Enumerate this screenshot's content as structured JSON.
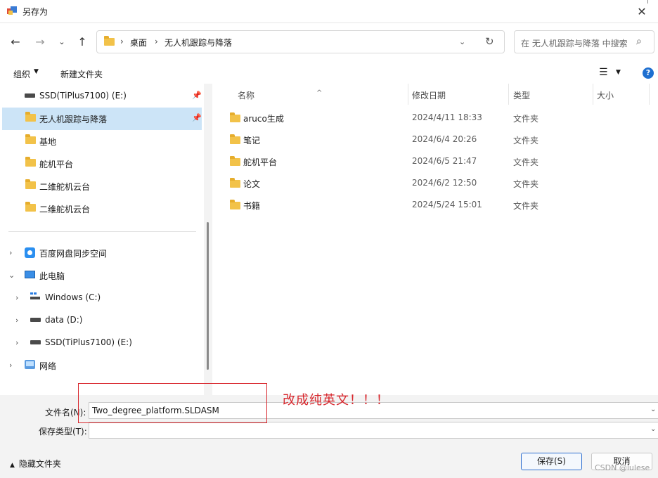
{
  "window": {
    "title": "另存为"
  },
  "address": {
    "crumbs": [
      "桌面",
      "无人机跟踪与降落"
    ],
    "search_placeholder": "在 无人机跟踪与降落 中搜索"
  },
  "toolbar": {
    "organize": "组织",
    "new_folder": "新建文件夹"
  },
  "sidebar": {
    "quick": [
      {
        "label": "SSD(TiPlus7100) (E:)",
        "icon": "drive-icon",
        "pinned": true
      },
      {
        "label": "无人机跟踪与降落",
        "icon": "folder-icon",
        "pinned": true,
        "selected": true
      },
      {
        "label": "基地",
        "icon": "folder-icon"
      },
      {
        "label": "舵机平台",
        "icon": "folder-icon"
      },
      {
        "label": "二维舵机云台",
        "icon": "folder-icon"
      },
      {
        "label": "二维舵机云台",
        "icon": "folder-icon"
      }
    ],
    "tree": [
      {
        "label": "百度网盘同步空间",
        "icon": "baidu-netdisk-icon",
        "expanded": false
      },
      {
        "label": "此电脑",
        "icon": "computer-icon",
        "expanded": true
      },
      {
        "label": "Windows (C:)",
        "icon": "windows-drive-icon",
        "expanded": false
      },
      {
        "label": "data (D:)",
        "icon": "drive-icon",
        "expanded": false
      },
      {
        "label": "SSD(TiPlus7100) (E:)",
        "icon": "drive-icon",
        "expanded": false
      },
      {
        "label": "网络",
        "icon": "network-icon",
        "expanded": false
      }
    ]
  },
  "files": {
    "columns": [
      "名称",
      "修改日期",
      "类型",
      "大小"
    ],
    "rows": [
      {
        "name": "aruco生成",
        "date": "2024/4/11 18:33",
        "type": "文件夹"
      },
      {
        "name": "笔记",
        "date": "2024/6/4 20:26",
        "type": "文件夹"
      },
      {
        "name": "舵机平台",
        "date": "2024/6/5 21:47",
        "type": "文件夹"
      },
      {
        "name": "论文",
        "date": "2024/6/2 12:50",
        "type": "文件夹"
      },
      {
        "name": "书籍",
        "date": "2024/5/24 15:01",
        "type": "文件夹"
      }
    ]
  },
  "form": {
    "filename_label": "文件名(N):",
    "filename_value": "Two_degree_platform.SLDASM",
    "filetype_label": "保存类型(T):",
    "filetype_value": ""
  },
  "footer": {
    "hide_folders": "隐藏文件夹",
    "save": "保存(S)",
    "cancel": "取消"
  },
  "annotation": {
    "text": "改成纯英文！！！"
  },
  "watermark": "CSDN @lulese"
}
